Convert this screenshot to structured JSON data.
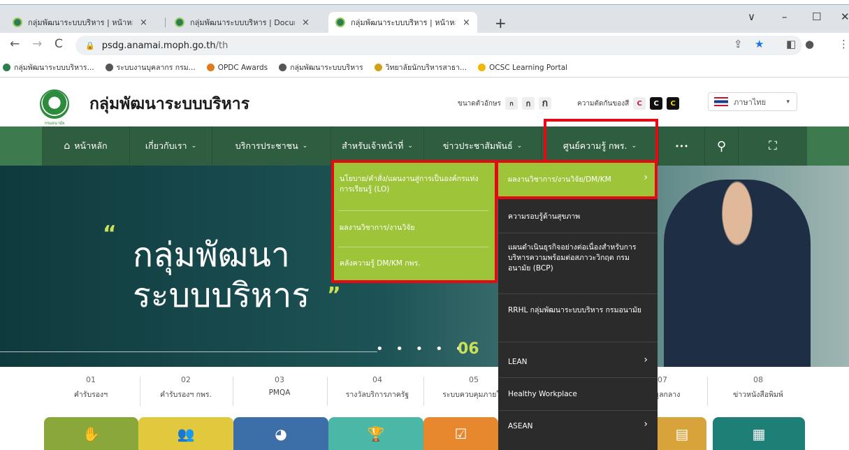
{
  "browser": {
    "tabs": [
      {
        "title": "กลุ่มพัฒนาระบบบริหาร | หน้าหลัก",
        "close": "×"
      },
      {
        "title": "กลุ่มพัฒนาระบบบริหาร | Document",
        "close": "×"
      },
      {
        "title": "กลุ่มพัฒนาระบบบริหาร | หน้าหลัก",
        "close": "×"
      }
    ],
    "new_tab": "+",
    "window_controls": [
      "∨",
      "–",
      "☐",
      "✕"
    ],
    "nav": {
      "back": "←",
      "forward": "→",
      "reload": "C"
    },
    "address": {
      "domain": "psdg.anamai.moph.go.th",
      "path": "/th"
    },
    "omnibox_icons": [
      "⇪",
      "★",
      "◧",
      "●",
      "⋮"
    ],
    "bookmarks": [
      {
        "label": "กลุ่มพัฒนาระบบบริหาร...",
        "color": "#2e7d4f"
      },
      {
        "label": "ระบบงานบุคลากร กรม...",
        "color": "#555555"
      },
      {
        "label": "OPDC Awards",
        "color": "#e07a1f"
      },
      {
        "label": "กลุ่มพัฒนาระบบบริหาร",
        "color": "#555555"
      },
      {
        "label": "วิทยาลัยนักบริหารสาธา...",
        "color": "#d4a017"
      },
      {
        "label": "OCSC Learning Portal",
        "color": "#f2b705"
      }
    ]
  },
  "site": {
    "title": "กลุ่มพัฒนาระบบบริหาร",
    "logo_caption": "กรมอนามัย",
    "font_size_label": "ขนาดตัวอักษร",
    "font_sizes": [
      "ก",
      "ก",
      "ก"
    ],
    "contrast_label": "ความตัดกันของสี",
    "contrast_opts": [
      "C",
      "C",
      "C"
    ],
    "language": "ภาษาไทย",
    "language_caret": "▾"
  },
  "nav": {
    "items": [
      {
        "label": "หน้าหลัก",
        "icon": "⌂"
      },
      {
        "label": "เกี่ยวกับเรา",
        "chev": "⌄"
      },
      {
        "label": "บริการประชาชน",
        "chev": "⌄"
      },
      {
        "label": "สำหรับเจ้าหน้าที่",
        "chev": "⌄"
      },
      {
        "label": "ข่าวประชาสัมพันธ์",
        "chev": "⌄"
      },
      {
        "label": "ศูนย์ความรู้ กพร.",
        "chev": "⌄"
      }
    ],
    "more": "•••",
    "search": "⚲",
    "sitemap": "⛶",
    "accent": "#2f5d3f"
  },
  "hero": {
    "quote_open": "“",
    "line1": "กลุ่มพัฒนา",
    "line2": "ระบบบริหาร",
    "quote_close": "”",
    "dots": "• • • • •",
    "slide_num": "06"
  },
  "dropdown1": [
    "นโยบาย/คำสั่ง/แผนงานสู่การเป็นองค์กรแห่งการเรียนรู้ (LO)",
    "ผลงานวิชาการ/งานวิจัย",
    "คลังความรู้ DM/KM กพร."
  ],
  "dropdown2": [
    {
      "label": "ผลงานวิชาการ/งานวิจัย/DM/KM",
      "arrow": "›"
    },
    {
      "label": "ความรอบรู้ด้านสุขภาพ"
    },
    {
      "label": "แผนดำเนินธุรกิจอย่างต่อเนื่องสำหรับการบริหารความพร้อมต่อสภาวะวิกฤต กรมอนามัย (BCP)"
    },
    {
      "label": "RRHL กลุ่มพัฒนาระบบบริหาร กรมอนามัย"
    },
    {
      "label": "LEAN",
      "arrow": "›"
    },
    {
      "label": "Healthy Workplace"
    },
    {
      "label": "ASEAN",
      "arrow": "›"
    }
  ],
  "quick_links": [
    {
      "num": "01",
      "label": "คำรับรองฯ"
    },
    {
      "num": "02",
      "label": "คำรับรองฯ กพร."
    },
    {
      "num": "03",
      "label": "PMQA"
    },
    {
      "num": "04",
      "label": "รางวัลบริการภาครัฐ"
    },
    {
      "num": "05",
      "label": "ระบบควบคุมภายใน"
    },
    {
      "num": "07",
      "label": "ข้อมูลกลาง"
    },
    {
      "num": "08",
      "label": "ข่าวหนังสือพิมพ์"
    }
  ],
  "tiles": [
    {
      "icon": "✋",
      "color": "#8aa83a"
    },
    {
      "icon": "👥",
      "color": "#e2c83c"
    },
    {
      "icon": "◕",
      "color": "#3c6ea8"
    },
    {
      "icon": "🏆",
      "color": "#4bb7a7"
    },
    {
      "icon": "☑",
      "color": "#e7882f"
    },
    {
      "icon": "▤",
      "color": "#d8a33a"
    },
    {
      "icon": "▦",
      "color": "#1e7f76"
    }
  ]
}
